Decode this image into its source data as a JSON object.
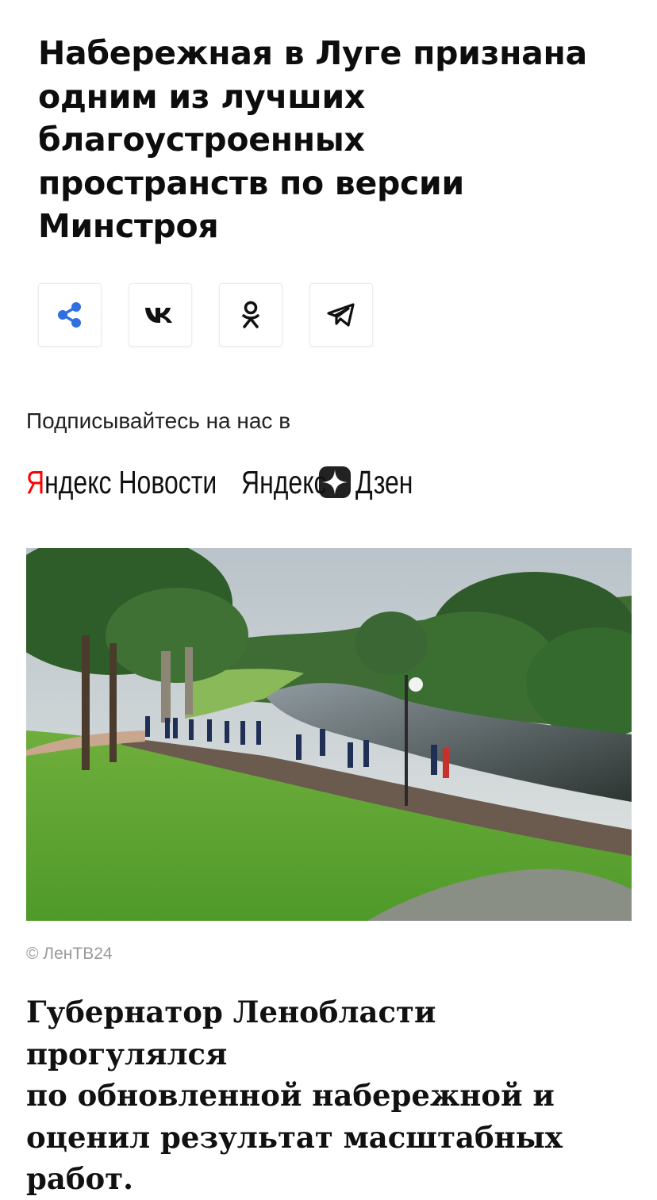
{
  "article": {
    "headline_lines": [
      "Набережная в Луге признана",
      "одним из лучших",
      "благоустроенных",
      "пространств по версии",
      "Минстроя"
    ],
    "share": [
      {
        "icon": "share-icon",
        "color": "#2f6fe0"
      },
      {
        "icon": "vk-icon",
        "color": "#111111"
      },
      {
        "icon": "odnoklassniki-icon",
        "color": "#111111"
      },
      {
        "icon": "telegram-icon",
        "color": "#111111"
      }
    ],
    "subscribe_text": "Подписывайтесь на нас в",
    "brands": {
      "news_y": "Я",
      "news_ndex": "ндекс",
      "news_word": "Новости",
      "zen_yandex": "Яндекс",
      "zen_word": "Дзен"
    },
    "photo_credit": "© ЛенТВ24",
    "lead_lines": [
      "Губернатор Ленобласти прогулялся",
      "по обновленной набережной и",
      "оценил результат масштабных",
      "работ."
    ]
  }
}
